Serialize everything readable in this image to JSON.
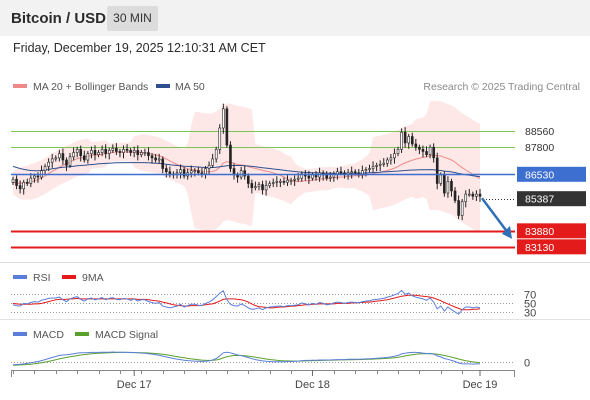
{
  "header": {
    "title": "Bitcoin / USD",
    "timeframe": "30 MIN",
    "timestamp": "Friday, December 19, 2025 12:10:31 AM CET"
  },
  "credit": "Research © 2025 Trading Central",
  "colors": {
    "resistance": "#7cc451",
    "pivot": "#3d6fd1",
    "support": "#e31b1b",
    "current": "#333333",
    "bollinger_fill": "#fde3e3",
    "ma20": "#f08a8a",
    "ma50": "#2f4f8f",
    "candle": "#222222",
    "candle_up": "#ffffff",
    "candle_wick": "#e06060",
    "rsi": "#5b7fd8",
    "rsi_ma": "#e31b1b",
    "macd": "#5b7fd8",
    "macd_signal": "#5aa02c",
    "arrow": "#2e6fb5"
  },
  "chart_data": [
    {
      "type": "line",
      "panel": "price",
      "legend": [
        {
          "name": "MA 20 + Bollinger Bands",
          "color": "#f08a8a"
        },
        {
          "name": "MA 50",
          "color": "#2f4f8f"
        }
      ],
      "x_ticks": [
        "Dec 17",
        "Dec 18",
        "Dec 19"
      ],
      "ylim": [
        82700,
        90200
      ],
      "levels": [
        {
          "label": "88560",
          "value": 88560,
          "kind": "resistance"
        },
        {
          "label": "87800",
          "value": 87800,
          "kind": "resistance"
        },
        {
          "label": "86530",
          "value": 86530,
          "kind": "pivot"
        },
        {
          "label": "85387",
          "value": 85387,
          "kind": "current"
        },
        {
          "label": "83880",
          "value": 83880,
          "kind": "support"
        },
        {
          "label": "83130",
          "value": 83130,
          "kind": "support"
        }
      ],
      "close": [
        86300,
        86000,
        85850,
        86150,
        86100,
        86350,
        86450,
        86400,
        86700,
        86900,
        87100,
        87250,
        87300,
        87500,
        87200,
        86950,
        87350,
        87550,
        87700,
        87400,
        87200,
        87500,
        87650,
        87450,
        87550,
        87700,
        87500,
        87650,
        87750,
        87600,
        87550,
        87700,
        87650,
        87550,
        87650,
        87450,
        87550,
        87550,
        87400,
        87300,
        87200,
        87250,
        86800,
        86650,
        86500,
        86550,
        86600,
        86750,
        86450,
        86600,
        86700,
        86700,
        86600,
        86550,
        86800,
        86950,
        87250,
        87700,
        88700,
        89600,
        87900,
        86800,
        86500,
        86400,
        86700,
        86450,
        86100,
        85900,
        85950,
        86050,
        85800,
        86000,
        86100,
        86150,
        86200,
        86200,
        86150,
        86250,
        86250,
        86300,
        86350,
        86550,
        86450,
        86350,
        86500,
        86400,
        86600,
        86500,
        86350,
        86400,
        86550,
        86650,
        86600,
        86500,
        86600,
        86650,
        86600,
        86550,
        86700,
        86750,
        86800,
        86900,
        86950,
        87000,
        87050,
        87200,
        87300,
        87500,
        87700,
        88500,
        88000,
        88300,
        87950,
        87800,
        87700,
        87600,
        87450,
        87800,
        87300,
        86100,
        86500,
        85650,
        86200,
        85750,
        85300,
        84600,
        85250,
        85600,
        85600,
        85500,
        85600,
        85500
      ],
      "ma20": [
        86150,
        86120,
        86110,
        86120,
        86140,
        86180,
        86220,
        86280,
        86360,
        86450,
        86560,
        86670,
        86760,
        86860,
        86950,
        87020,
        87100,
        87190,
        87270,
        87300,
        87330,
        87370,
        87410,
        87430,
        87440,
        87470,
        87500,
        87530,
        87560,
        87570,
        87570,
        87580,
        87580,
        87570,
        87580,
        87560,
        87550,
        87540,
        87510,
        87480,
        87440,
        87400,
        87330,
        87250,
        87160,
        87080,
        86990,
        86930,
        86850,
        86790,
        86760,
        86730,
        86710,
        86670,
        86640,
        86640,
        86660,
        86720,
        86860,
        87060,
        87120,
        87100,
        87050,
        86990,
        86970,
        86940,
        86890,
        86840,
        86800,
        86770,
        86710,
        86680,
        86640,
        86600,
        86540,
        86480,
        86400,
        86310,
        86240,
        86200,
        86190,
        86210,
        86220,
        86230,
        86260,
        86280,
        86310,
        86320,
        86330,
        86350,
        86370,
        86390,
        86400,
        86410,
        86430,
        86450,
        86460,
        86460,
        86480,
        86500,
        86520,
        86560,
        86600,
        86630,
        86670,
        86710,
        86760,
        86820,
        86890,
        86990,
        87060,
        87130,
        87190,
        87240,
        87280,
        87320,
        87350,
        87400,
        87420,
        87400,
        87390,
        87320,
        87270,
        87200,
        87100,
        86960,
        86840,
        86730,
        86630,
        86520,
        86420,
        86330
      ],
      "ma50": [
        86900,
        86850,
        86800,
        86760,
        86730,
        86710,
        86700,
        86700,
        86710,
        86730,
        86760,
        86790,
        86810,
        86840,
        86860,
        86870,
        86890,
        86910,
        86930,
        86940,
        86950,
        86970,
        86990,
        87000,
        87020,
        87030,
        87040,
        87050,
        87060,
        87070,
        87070,
        87080,
        87080,
        87080,
        87080,
        87080,
        87080,
        87080,
        87070,
        87060,
        87050,
        87040,
        87020,
        87000,
        86980,
        86960,
        86940,
        86930,
        86910,
        86900,
        86890,
        86880,
        86870,
        86860,
        86850,
        86850,
        86850,
        86860,
        86880,
        86910,
        86930,
        86940,
        86940,
        86940,
        86940,
        86930,
        86920,
        86900,
        86880,
        86860,
        86840,
        86820,
        86800,
        86780,
        86760,
        86740,
        86720,
        86700,
        86680,
        86660,
        86640,
        86630,
        86620,
        86610,
        86600,
        86600,
        86590,
        86590,
        86580,
        86580,
        86580,
        86580,
        86580,
        86580,
        86580,
        86580,
        86580,
        86580,
        86590,
        86590,
        86600,
        86610,
        86620,
        86630,
        86640,
        86650,
        86660,
        86670,
        86680,
        86700,
        86710,
        86720,
        86730,
        86730,
        86740,
        86740,
        86740,
        86750,
        86740,
        86720,
        86710,
        86680,
        86660,
        86640,
        86610,
        86570,
        86540,
        86510,
        86490,
        86460,
        86440,
        86420
      ]
    },
    {
      "type": "line",
      "panel": "rsi",
      "legend": [
        {
          "name": "RSI",
          "color": "#5b7fd8"
        },
        {
          "name": "9MA",
          "color": "#e31b1b"
        }
      ],
      "levels": [
        {
          "label": "70",
          "value": 70
        },
        {
          "label": "50",
          "value": 50
        },
        {
          "label": "30",
          "value": 30
        }
      ],
      "ylim": [
        20,
        80
      ],
      "rsi": [
        45,
        43,
        42,
        48,
        47,
        50,
        52,
        51,
        55,
        57,
        59,
        60,
        60,
        62,
        56,
        52,
        58,
        61,
        63,
        57,
        53,
        58,
        60,
        56,
        58,
        61,
        56,
        59,
        61,
        57,
        56,
        59,
        58,
        55,
        58,
        53,
        56,
        56,
        52,
        50,
        48,
        50,
        42,
        40,
        38,
        40,
        42,
        46,
        40,
        43,
        46,
        46,
        44,
        43,
        48,
        51,
        56,
        63,
        71,
        76,
        56,
        46,
        43,
        42,
        47,
        43,
        38,
        35,
        36,
        38,
        34,
        38,
        40,
        41,
        42,
        42,
        41,
        43,
        43,
        44,
        45,
        49,
        47,
        45,
        48,
        46,
        50,
        48,
        45,
        46,
        49,
        51,
        50,
        48,
        50,
        51,
        50,
        49,
        52,
        53,
        54,
        56,
        57,
        58,
        59,
        62,
        64,
        67,
        70,
        77,
        68,
        71,
        65,
        62,
        60,
        58,
        55,
        60,
        51,
        36,
        42,
        31,
        40,
        34,
        29,
        24,
        34,
        40,
        40,
        38,
        40,
        38
      ],
      "ma9": [
        48,
        47,
        46,
        46,
        46,
        46,
        47,
        47,
        48,
        50,
        52,
        54,
        56,
        57,
        57,
        57,
        58,
        58,
        59,
        58,
        58,
        58,
        58,
        58,
        58,
        58,
        58,
        58,
        58,
        58,
        58,
        58,
        58,
        58,
        58,
        57,
        57,
        57,
        56,
        55,
        54,
        53,
        51,
        49,
        47,
        45,
        44,
        43,
        42,
        42,
        43,
        43,
        43,
        44,
        45,
        46,
        47,
        50,
        53,
        57,
        58,
        58,
        58,
        57,
        56,
        54,
        51,
        47,
        43,
        41,
        40,
        39,
        38,
        38,
        39,
        40,
        40,
        41,
        42,
        42,
        43,
        44,
        45,
        45,
        46,
        46,
        47,
        47,
        47,
        47,
        47,
        48,
        48,
        48,
        48,
        49,
        49,
        50,
        50,
        51,
        51,
        52,
        53,
        54,
        55,
        56,
        58,
        60,
        62,
        64,
        65,
        66,
        66,
        66,
        65,
        64,
        63,
        62,
        60,
        57,
        54,
        50,
        47,
        43,
        40,
        37,
        34,
        34,
        34,
        35,
        35,
        36
      ]
    },
    {
      "type": "line",
      "panel": "macd",
      "legend": [
        {
          "name": "MACD",
          "color": "#5b7fd8"
        },
        {
          "name": "MACD Signal",
          "color": "#5aa02c"
        }
      ],
      "levels": [
        {
          "label": "0",
          "value": 0
        }
      ],
      "ylim": [
        -300,
        900
      ],
      "macd": [
        -150,
        -140,
        -130,
        -110,
        -90,
        -60,
        -30,
        0,
        40,
        90,
        140,
        190,
        230,
        280,
        300,
        310,
        330,
        360,
        390,
        400,
        400,
        410,
        420,
        420,
        420,
        430,
        430,
        430,
        440,
        430,
        430,
        430,
        420,
        410,
        410,
        400,
        390,
        380,
        360,
        340,
        310,
        290,
        250,
        210,
        170,
        140,
        110,
        90,
        60,
        40,
        30,
        20,
        10,
        0,
        10,
        30,
        70,
        140,
        260,
        400,
        430,
        400,
        350,
        300,
        270,
        230,
        180,
        130,
        90,
        60,
        30,
        10,
        0,
        -10,
        -10,
        -10,
        -10,
        0,
        0,
        10,
        20,
        40,
        50,
        50,
        60,
        60,
        70,
        70,
        70,
        70,
        80,
        90,
        90,
        90,
        100,
        100,
        100,
        100,
        110,
        120,
        130,
        140,
        150,
        160,
        170,
        190,
        210,
        240,
        280,
        350,
        380,
        410,
        420,
        420,
        410,
        390,
        370,
        370,
        340,
        260,
        210,
        140,
        100,
        50,
        0,
        -70,
        -100,
        -110,
        -110,
        -120,
        -110,
        -110
      ],
      "signal": [
        -170,
        -165,
        -158,
        -149,
        -138,
        -123,
        -104,
        -83,
        -58,
        -28,
        6,
        43,
        80,
        120,
        156,
        187,
        216,
        245,
        274,
        299,
        319,
        337,
        354,
        367,
        378,
        388,
        397,
        403,
        411,
        415,
        418,
        420,
        420,
        418,
        416,
        413,
        408,
        402,
        394,
        383,
        368,
        352,
        332,
        308,
        280,
        252,
        224,
        197,
        170,
        144,
        121,
        101,
        83,
        66,
        55,
        50,
        54,
        71,
        109,
        167,
        220,
        256,
        275,
        280,
        278,
        268,
        250,
        226,
        199,
        171,
        143,
        116,
        93,
        72,
        56,
        43,
        32,
        26,
        21,
        19,
        19,
        23,
        28,
        33,
        38,
        42,
        48,
        52,
        56,
        59,
        63,
        68,
        73,
        76,
        81,
        85,
        88,
        90,
        94,
        99,
        105,
        112,
        120,
        128,
        136,
        147,
        159,
        175,
        196,
        227,
        257,
        288,
        314,
        335,
        350,
        358,
        360,
        362,
        358,
        339,
        313,
        279,
        243,
        204,
        163,
        117,
        73,
        37,
        7,
        -18,
        -36,
        -51
      ]
    }
  ]
}
